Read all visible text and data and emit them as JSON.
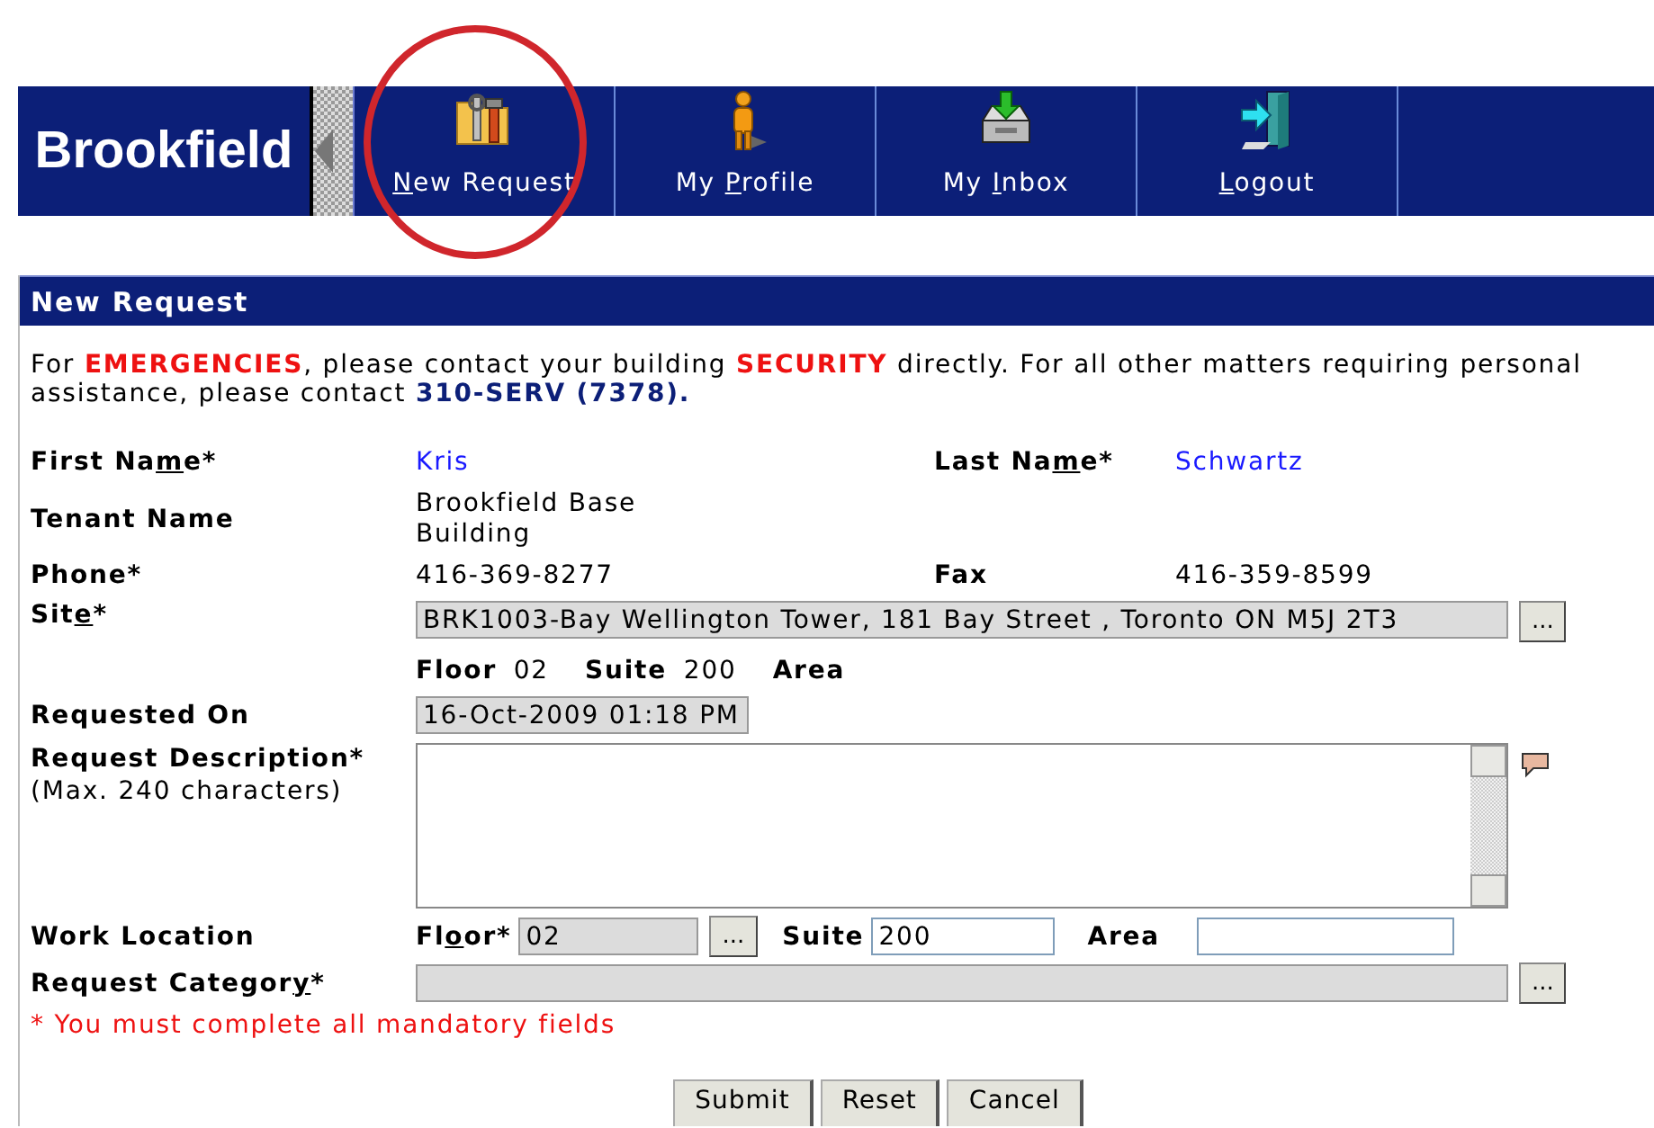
{
  "header": {
    "logo": "Brookfield",
    "nav": [
      {
        "kind": "tools",
        "key": "N",
        "post": "ew Request",
        "circled": true
      },
      {
        "kind": "person",
        "pre": "My ",
        "key": "P",
        "post": "rofile",
        "circled": false
      },
      {
        "kind": "inbox",
        "pre": "My ",
        "key": "I",
        "post": "nbox",
        "circled": false
      },
      {
        "kind": "door",
        "key": "L",
        "post": "ogout",
        "circled": false
      }
    ]
  },
  "panel": {
    "title": "New Request",
    "notice": [
      {
        "text": "For ",
        "kind": "plain"
      },
      {
        "text": "EMERGENCIES",
        "kind": "alert"
      },
      {
        "text": ", please contact your building ",
        "kind": "plain"
      },
      {
        "text": "SECURITY",
        "kind": "alert"
      },
      {
        "text": " directly. For all other matters requiring personal assistance, please contact ",
        "kind": "plain"
      },
      {
        "text": "310-SERV (7378).",
        "kind": "contact"
      }
    ],
    "first_name": {
      "label": {
        "pre": "First Na",
        "key": "m",
        "post": "e*"
      },
      "value": "Kris"
    },
    "last_name": {
      "label": {
        "pre": "Last Na",
        "key": "m",
        "post": "e*"
      },
      "value": "Schwartz"
    },
    "tenant_name": {
      "label": {
        "pre": "Tenant Name"
      },
      "value": "Brookfield Base Building"
    },
    "phone": {
      "label": {
        "pre": "Phone*"
      },
      "value": "416-369-8277"
    },
    "fax": {
      "label": {
        "pre": "Fax"
      },
      "value": "416-359-8599"
    },
    "site": {
      "label": {
        "pre": "Sit",
        "key": "e",
        "post": "*"
      },
      "value": "BRK1003-Bay Wellington Tower, 181 Bay Street , Toronto ON M5J 2T3",
      "disabled": true,
      "button": "..."
    },
    "site_location": [
      {
        "label": "Floor",
        "value": "02"
      },
      {
        "label": "Suite",
        "value": "200"
      },
      {
        "label": "Area"
      }
    ],
    "requested_on": {
      "label": {
        "pre": "Requested On"
      },
      "value": "16-Oct-2009 01:18 PM",
      "disabled": true
    },
    "description": {
      "label": {
        "pre": "Request Description*"
      },
      "hint": "(Max. 240 characters)"
    },
    "work_location": {
      "label": {
        "pre": "Work Location"
      },
      "floor": {
        "label": {
          "pre": "Fl",
          "key": "o",
          "post": "or*"
        },
        "value": "02",
        "disabled": true,
        "button": "..."
      },
      "suite": {
        "label": {
          "pre": "Suite"
        },
        "value": "200",
        "disabled": false
      },
      "area": {
        "label": {
          "pre": "Area"
        },
        "disabled": false
      }
    },
    "request_category": {
      "label": {
        "pre": "Request Categor",
        "key": "y",
        "post": "*"
      },
      "disabled": true,
      "button": "..."
    },
    "required_note": "* You must complete all mandatory fields",
    "buttons": [
      "Submit",
      "Reset",
      "Cancel"
    ]
  }
}
